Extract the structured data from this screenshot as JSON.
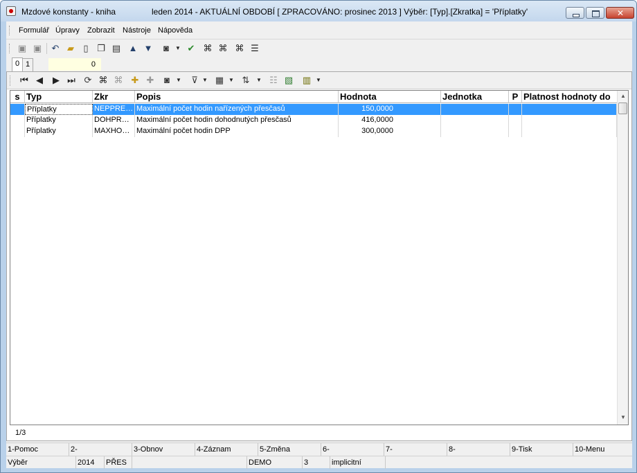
{
  "window": {
    "title": "Mzdové konstanty - kniha",
    "context": "leden 2014 - AKTUÁLNÍ OBDOBÍ [ ZPRACOVÁNO: prosinec 2013 ] Výběr: [Typ].[Zkratka] = 'Příplatky'"
  },
  "menu": [
    "Formulář",
    "Úpravy",
    "Zobrazit",
    "Nástroje",
    "Nápověda"
  ],
  "tabs": [
    {
      "label": "0",
      "active": true
    },
    {
      "label": "1",
      "active": false
    }
  ],
  "tab_value": "0",
  "grid": {
    "columns": [
      "s",
      "Typ",
      "Zkr",
      "Popis",
      "Hodnota",
      "Jednotka",
      "P",
      "Platnost hodnoty do"
    ],
    "rows": [
      {
        "s": "",
        "typ": "Příplatky",
        "zkr": "NEPPRESC",
        "popis": "Maximální počet hodin nařízených přesčasů",
        "hodnota": "150,0000",
        "jednotka": "",
        "p": "",
        "platnost": "",
        "selected": true
      },
      {
        "s": "",
        "typ": "Příplatky",
        "zkr": "DOHPRESC",
        "popis": "Maximální počet hodin dohodnutých přesčasů",
        "hodnota": "416,0000",
        "jednotka": "",
        "p": "",
        "platnost": "",
        "selected": false
      },
      {
        "s": "",
        "typ": "Příplatky",
        "zkr": "MAXHODDPP",
        "popis": "Maximální počet hodin DPP",
        "hodnota": "300,0000",
        "jednotka": "",
        "p": "",
        "platnost": "",
        "selected": false
      }
    ]
  },
  "record_count": "1/3",
  "function_keys": [
    "1-Pomoc",
    "2-",
    "3-Obnov",
    "4-Záznam",
    "5-Změna",
    "6-",
    "7-",
    "8-",
    "9-Tisk",
    "10-Menu"
  ],
  "status": [
    "Výběr",
    "2014",
    "PŘES",
    "",
    "DEMO",
    "3",
    "implicitní"
  ],
  "colors": {
    "selection": "#3399ff",
    "tab_value_bg": "#ffffe1",
    "window_frame": "#b9d1ea"
  }
}
